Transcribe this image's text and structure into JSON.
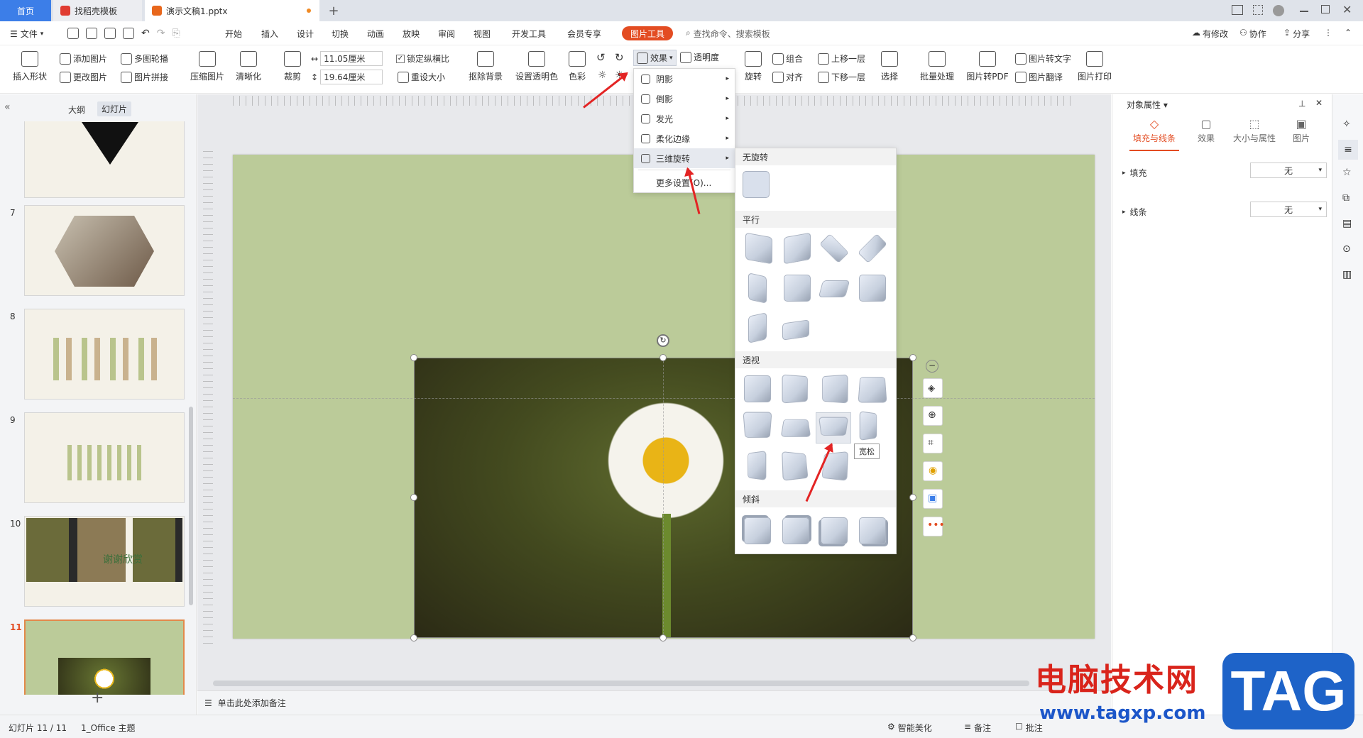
{
  "tabs": {
    "home": "首页",
    "template": "找稻壳模板",
    "doc": "演示文稿1.pptx",
    "add": "+"
  },
  "menu": {
    "file": "文件",
    "items": [
      "开始",
      "插入",
      "设计",
      "切换",
      "动画",
      "放映",
      "审阅",
      "视图",
      "开发工具",
      "会员专享"
    ],
    "picture_tools": "图片工具",
    "search": "查找命令、搜索模板",
    "modified": "有修改",
    "collab": "协作",
    "share": "分享"
  },
  "ribbon": {
    "insert_shape": "插入形状",
    "add_picture": "添加图片",
    "change_picture": "更改图片",
    "multi_outline": "多图轮播",
    "picture_splice": "图片拼接",
    "compress": "压缩图片",
    "sharpen": "清晰化",
    "crop": "裁剪",
    "width": "11.05厘米",
    "height": "19.64厘米",
    "lock_ratio": "锁定纵横比",
    "reset_size": "重设大小",
    "remove_bg": "抠除背景",
    "set_transparent": "设置透明色",
    "color": "色彩",
    "effects": "效果",
    "transparency": "透明度",
    "rotate": "旋转",
    "group": "组合",
    "align": "对齐",
    "bring_forward": "上移一层",
    "send_backward": "下移一层",
    "select": "选择",
    "batch": "批量处理",
    "to_pdf": "图片转PDF",
    "to_text": "图片转文字",
    "translate": "图片翻译",
    "print": "图片打印"
  },
  "left": {
    "outline": "大纲",
    "slides": "幻灯片",
    "nums": [
      "7",
      "8",
      "9",
      "10",
      "11"
    ],
    "thumb10_text": "谢谢欣赏",
    "add": "+"
  },
  "effects_menu": {
    "items": [
      "阴影",
      "倒影",
      "发光",
      "柔化边缘",
      "三维旋转"
    ],
    "more": "更多设置(O)..."
  },
  "rotation_menu": {
    "no_rotation": "无旋转",
    "parallel": "平行",
    "perspective": "透视",
    "oblique": "倾斜",
    "tooltip": "宽松"
  },
  "right": {
    "title": "对象属性",
    "tabs": [
      "填充与线条",
      "效果",
      "大小与属性",
      "图片"
    ],
    "fill": "填充",
    "line": "线条",
    "fill_value": "无",
    "line_value": "无"
  },
  "notes": "单击此处添加备注",
  "status": {
    "slide": "幻灯片 11 / 11",
    "theme": "1_Office 主题",
    "beautify": "智能美化",
    "notes": "备注",
    "comment": "批注"
  },
  "watermark": {
    "site": "电脑技术网",
    "url": "www.tagxp.com",
    "tag": "TAG"
  },
  "colors": {
    "accent": "#e34c22",
    "slide_bg": "#bbcb99",
    "menu_highlight": "#e6e9ef"
  }
}
